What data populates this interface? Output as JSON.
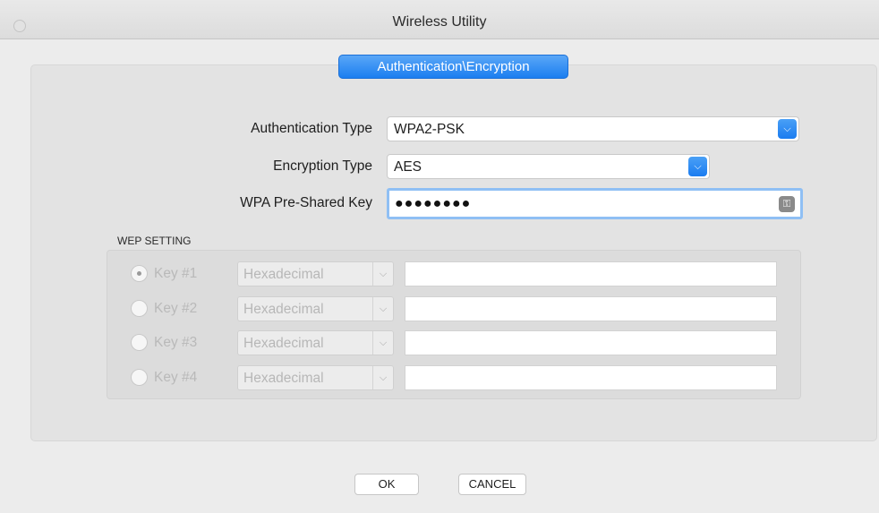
{
  "window": {
    "title": "Wireless Utility"
  },
  "tab": {
    "label": "Authentication\\Encryption"
  },
  "form": {
    "auth_type_label": "Authentication Type",
    "auth_type_value": "WPA2-PSK",
    "enc_type_label": "Encryption Type",
    "enc_type_value": "AES",
    "psk_label": "WPA Pre-Shared Key",
    "psk_value": "●●●●●●●●"
  },
  "wep": {
    "section_title": "WEP SETTING",
    "keys": [
      {
        "label": "Key #1",
        "format": "Hexadecimal",
        "selected": true
      },
      {
        "label": "Key #2",
        "format": "Hexadecimal",
        "selected": false
      },
      {
        "label": "Key #3",
        "format": "Hexadecimal",
        "selected": false
      },
      {
        "label": "Key #4",
        "format": "Hexadecimal",
        "selected": false
      }
    ]
  },
  "buttons": {
    "ok": "OK",
    "cancel": "CANCEL"
  },
  "colors": {
    "accent": "#1b7ef0",
    "focus_ring": "#8fbff4",
    "disabled_text": "#b9b9b9"
  },
  "icons": {
    "dropdown": "chevron-down-icon",
    "key": "key-icon",
    "window_close": "close-icon"
  }
}
